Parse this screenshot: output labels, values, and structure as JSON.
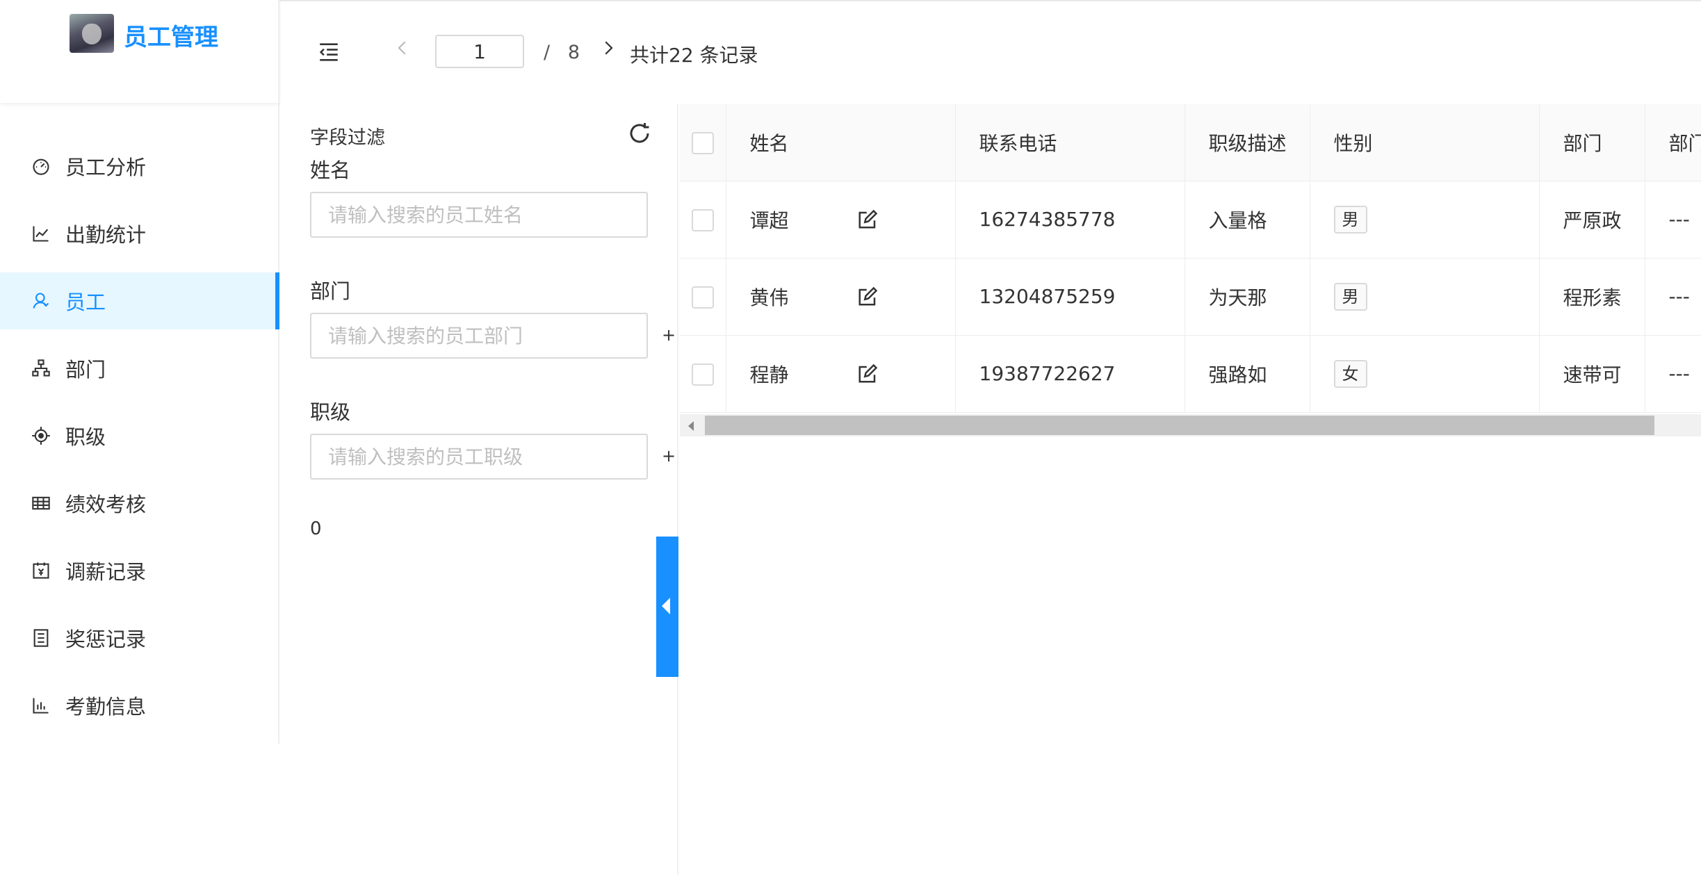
{
  "app": {
    "title": "员工管理"
  },
  "sidebar": {
    "items": [
      {
        "label": "员工分析",
        "icon": "dashboard-icon",
        "active": false
      },
      {
        "label": "出勤统计",
        "icon": "line-chart-icon",
        "active": false
      },
      {
        "label": "员工",
        "icon": "user-icon",
        "active": true
      },
      {
        "label": "部门",
        "icon": "org-tree-icon",
        "active": false
      },
      {
        "label": "职级",
        "icon": "aim-icon",
        "active": false
      },
      {
        "label": "绩效考核",
        "icon": "table-icon",
        "active": false
      },
      {
        "label": "调薪记录",
        "icon": "calendar-yen-icon",
        "active": false
      },
      {
        "label": "奖惩记录",
        "icon": "file-list-icon",
        "active": false
      },
      {
        "label": "考勤信息",
        "icon": "bar-chart-icon",
        "active": false
      }
    ]
  },
  "pagination": {
    "current_page": "1",
    "separator": "/",
    "total_pages": "8",
    "total_text": "共计22 条记录"
  },
  "filter": {
    "title": "字段过滤",
    "name_label": "姓名",
    "name_placeholder": "请输入搜索的员工姓名",
    "dept_label": "部门",
    "dept_placeholder": "请输入搜索的员工部门",
    "level_label": "职级",
    "level_placeholder": "请输入搜索的员工职级",
    "plus": "+",
    "count": "0"
  },
  "table": {
    "headers": {
      "name": "姓名",
      "phone": "联系电话",
      "level": "职级描述",
      "gender": "性别",
      "dept": "部门",
      "dept2": "部门"
    },
    "rows": [
      {
        "name": "谭超",
        "phone": "16274385778",
        "level": "入量格",
        "gender": "男",
        "dept": "严原政",
        "dept2": "---"
      },
      {
        "name": "黄伟",
        "phone": "13204875259",
        "level": "为天那",
        "gender": "男",
        "dept": "程形素",
        "dept2": "---"
      },
      {
        "name": "程静",
        "phone": "19387722627",
        "level": "强路如",
        "gender": "女",
        "dept": "速带可",
        "dept2": "---"
      }
    ]
  },
  "colors": {
    "primary": "#1890ff",
    "active_bg": "#e6f7ff"
  }
}
